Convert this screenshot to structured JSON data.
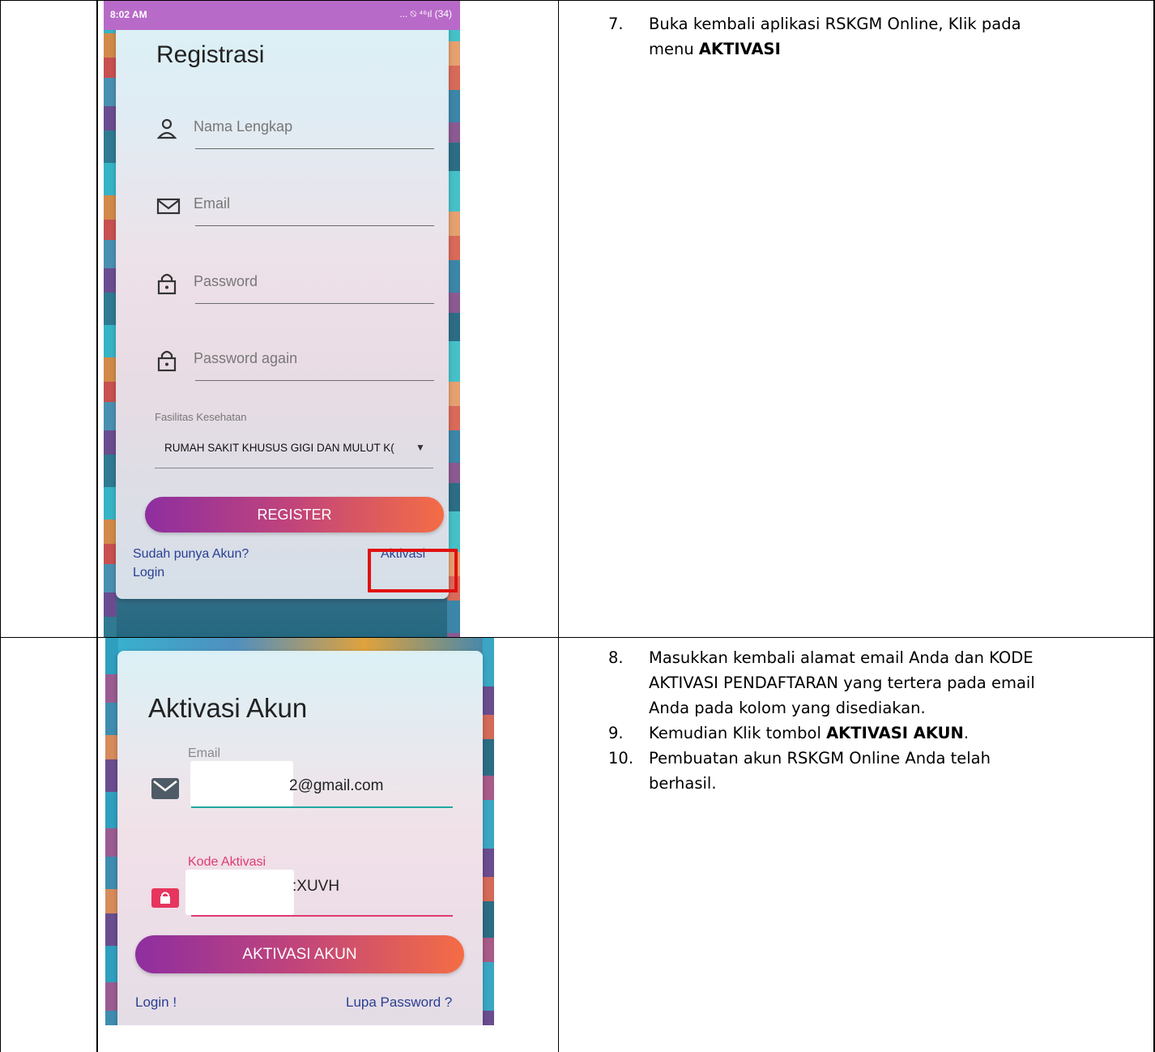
{
  "screenshot_register": {
    "status_time": "8:02 AM",
    "status_icons": "... ⍉ ⁴⁶ıl (34)",
    "title": "Registrasi",
    "fields": [
      {
        "placeholder": "Nama Lengkap",
        "icon": "person-icon"
      },
      {
        "placeholder": "Email",
        "icon": "mail-icon"
      },
      {
        "placeholder": "Password",
        "icon": "lock-icon"
      },
      {
        "placeholder": "Password again",
        "icon": "lock-icon"
      }
    ],
    "facility_label": "Fasilitas Kesehatan",
    "facility_value": "RUMAH SAKIT KHUSUS GIGI DAN MULUT K(",
    "facility_arrow": "▼",
    "register_button": "REGISTER",
    "have_account": "Sudah punya Akun?",
    "login_link": "Login",
    "activation_link": "Aktivasi",
    "highlight_color": "#e11010"
  },
  "screenshot_activation": {
    "title": "Aktivasi Akun",
    "email_label": "Email",
    "email_value": "2@gmail.com",
    "code_label": "Kode Aktivasi",
    "code_value": ":XUVH",
    "activate_button": "AKTIVASI AKUN",
    "login_link": "Login !",
    "forgot_link": "Lupa Password ?"
  },
  "steps": {
    "step7": {
      "number": "7.",
      "text_line1": "Buka kembali aplikasi RSKGM Online, Klik pada",
      "text_line2_prefix": "menu ",
      "text_line2_bold": "AKTIVASI"
    },
    "step8": {
      "number": "8.",
      "line1": "Masukkan kembali alamat email Anda dan KODE",
      "line2": "AKTIVASI PENDAFTARAN yang tertera pada email",
      "line3": "Anda pada kolom yang disediakan."
    },
    "step9": {
      "number": "9.",
      "prefix": "Kemudian Klik tombol ",
      "bold": "AKTIVASI AKUN",
      "suffix": "."
    },
    "step10": {
      "number": "10.",
      "line1": "Pembuatan akun RSKGM Online Anda telah",
      "line2": "berhasil."
    }
  }
}
